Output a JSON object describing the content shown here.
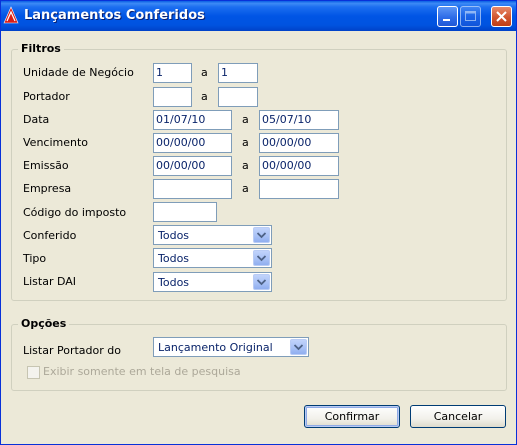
{
  "window": {
    "title": "Lançamentos Conferidos"
  },
  "filtros": {
    "title": "Filtros",
    "unidade_negocio": {
      "label": "Unidade de Negócio",
      "from": "1",
      "sep": "a",
      "to": "1"
    },
    "portador": {
      "label": "Portador",
      "from": "",
      "sep": "a",
      "to": ""
    },
    "data": {
      "label": "Data",
      "from": "01/07/10",
      "sep": "a",
      "to": "05/07/10"
    },
    "vencimento": {
      "label": "Vencimento",
      "from": "00/00/00",
      "sep": "a",
      "to": "00/00/00"
    },
    "emissao": {
      "label": "Emissão",
      "from": "00/00/00",
      "sep": "a",
      "to": "00/00/00"
    },
    "empresa": {
      "label": "Empresa",
      "from": "",
      "sep": "a",
      "to": ""
    },
    "codigo_imposto": {
      "label": "Código do imposto",
      "value": ""
    },
    "conferido": {
      "label": "Conferido",
      "value": "Todos"
    },
    "tipo": {
      "label": "Tipo",
      "value": "Todos"
    },
    "listar_dai": {
      "label": "Listar DAI",
      "value": "Todos"
    }
  },
  "opcoes": {
    "title": "Opções",
    "listar_portador": {
      "label": "Listar Portador do",
      "value": "Lançamento Original"
    },
    "exibir_tela": {
      "label": "Exibir somente em tela de pesquisa",
      "checked": false
    }
  },
  "buttons": {
    "confirmar": "Confirmar",
    "cancelar": "Cancelar"
  },
  "colors": {
    "title_bar": "#0055E5",
    "window_bg": "#ECE9D8",
    "field_text": "#0A246A",
    "field_border": "#7F9DB9"
  }
}
